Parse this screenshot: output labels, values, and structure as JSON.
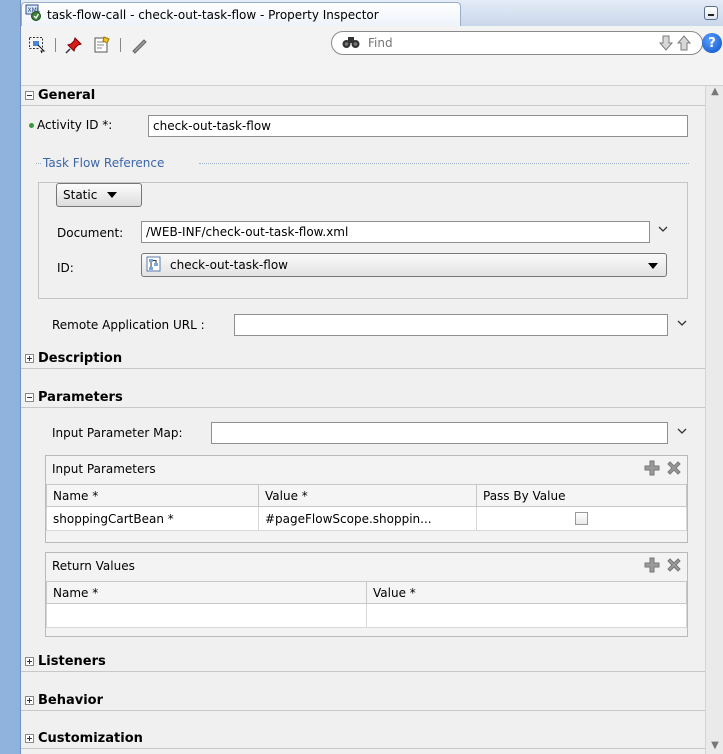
{
  "window": {
    "title": "task-flow-call - check-out-task-flow - Property Inspector"
  },
  "toolbar": {
    "find_placeholder": "Find"
  },
  "sections": {
    "general": "General",
    "description": "Description",
    "parameters": "Parameters",
    "listeners": "Listeners",
    "behavior": "Behavior",
    "customization": "Customization"
  },
  "general": {
    "activity_id_label": "Activity ID *:",
    "activity_id_value": "check-out-task-flow",
    "task_flow_reference_label": "Task Flow Reference",
    "static_value": "Static",
    "document_label": "Document:",
    "document_value": "/WEB-INF/check-out-task-flow.xml",
    "id_label": "ID:",
    "id_value": "check-out-task-flow",
    "remote_url_label": "Remote Application URL :",
    "remote_url_value": ""
  },
  "parameters": {
    "input_map_label": "Input Parameter Map:",
    "input_map_value": "",
    "input_params_title": "Input Parameters",
    "input_columns": [
      "Name *",
      "Value *",
      "Pass By Value"
    ],
    "input_rows": [
      {
        "name": "shoppingCartBean *",
        "value": "#pageFlowScope.shoppin...",
        "pass_by_value": false
      }
    ],
    "return_values_title": "Return Values",
    "return_columns": [
      "Name *",
      "Value *"
    ]
  }
}
